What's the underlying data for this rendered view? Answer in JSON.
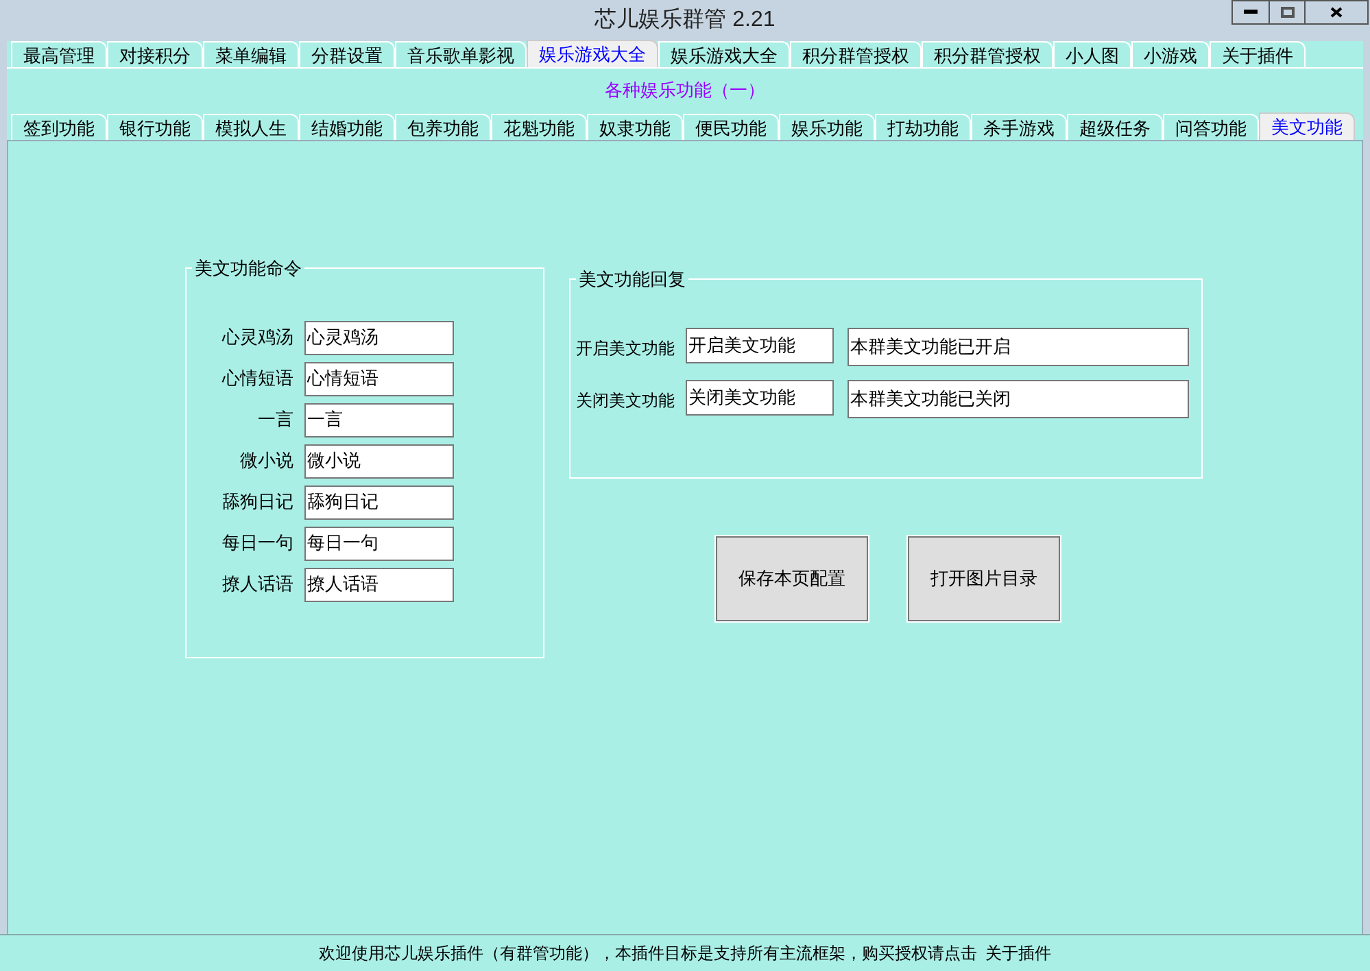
{
  "window": {
    "title": "芯儿娱乐群管 2.21"
  },
  "tabs": [
    {
      "label": "最高管理",
      "selected": false
    },
    {
      "label": "对接积分",
      "selected": false
    },
    {
      "label": "菜单编辑",
      "selected": false
    },
    {
      "label": "分群设置",
      "selected": false
    },
    {
      "label": "音乐歌单影视",
      "selected": false
    },
    {
      "label": "娱乐游戏大全",
      "selected": true
    },
    {
      "label": "娱乐游戏大全",
      "selected": false
    },
    {
      "label": "积分群管授权",
      "selected": false
    },
    {
      "label": "积分群管授权",
      "selected": false
    },
    {
      "label": "小人图",
      "selected": false
    },
    {
      "label": "小游戏",
      "selected": false
    },
    {
      "label": "关于插件",
      "selected": false
    }
  ],
  "subtitle": "各种娱乐功能（一）",
  "sub_tabs": [
    {
      "label": "签到功能",
      "selected": false
    },
    {
      "label": "银行功能",
      "selected": false
    },
    {
      "label": "模拟人生",
      "selected": false
    },
    {
      "label": "结婚功能",
      "selected": false
    },
    {
      "label": "包养功能",
      "selected": false
    },
    {
      "label": "花魁功能",
      "selected": false
    },
    {
      "label": "奴隶功能",
      "selected": false
    },
    {
      "label": "便民功能",
      "selected": false
    },
    {
      "label": "娱乐功能",
      "selected": false
    },
    {
      "label": "打劫功能",
      "selected": false
    },
    {
      "label": "杀手游戏",
      "selected": false
    },
    {
      "label": "超级任务",
      "selected": false
    },
    {
      "label": "问答功能",
      "selected": false
    },
    {
      "label": "美文功能",
      "selected": true
    }
  ],
  "command_group": {
    "title": "美文功能命令",
    "fields": [
      {
        "label": "心灵鸡汤",
        "value": "心灵鸡汤"
      },
      {
        "label": "心情短语",
        "value": "心情短语"
      },
      {
        "label": "一言",
        "value": "一言"
      },
      {
        "label": "微小说",
        "value": "微小说"
      },
      {
        "label": "舔狗日记",
        "value": "舔狗日记"
      },
      {
        "label": "每日一句",
        "value": "每日一句"
      },
      {
        "label": "撩人话语",
        "value": "撩人话语"
      }
    ]
  },
  "reply_group": {
    "title": "美文功能回复",
    "rows": [
      {
        "label": "开启美文功能",
        "command": "开启美文功能",
        "reply": "本群美文功能已开启"
      },
      {
        "label": "关闭美文功能",
        "command": "关闭美文功能",
        "reply": "本群美文功能已关闭"
      }
    ]
  },
  "buttons": [
    "保存本页配置",
    "打开图片目录"
  ],
  "status_bar": {
    "text": "欢迎使用芯儿娱乐插件（有群管功能），本插件目标是支持所有主流框架，购买授权请点击",
    "link": "关于插件"
  }
}
